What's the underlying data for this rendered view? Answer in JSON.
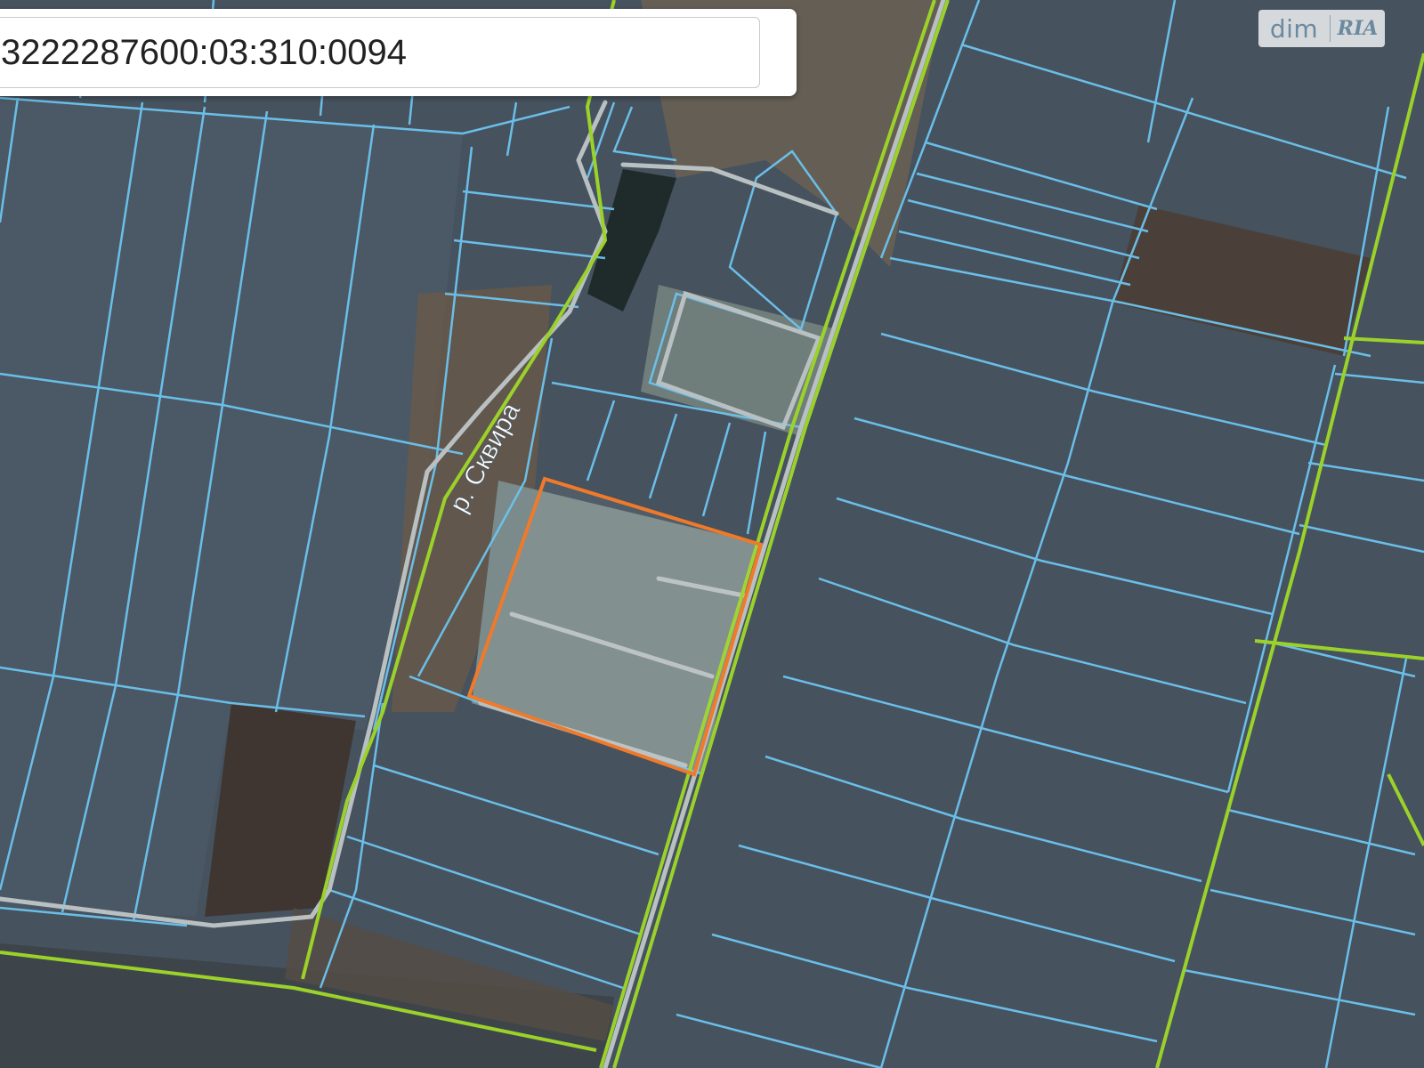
{
  "search": {
    "value": "3222287600:03:310:0094",
    "placeholder": ""
  },
  "map": {
    "river_label": "р. Сквира",
    "colors": {
      "parcel_border": "#6cc4f0",
      "road_border": "#9bd22a",
      "selected_parcel": "#f07a2a",
      "field": "#4a5865",
      "bare_soil": "#4d4038"
    }
  },
  "watermark": {
    "dim": "dim",
    "ria": "RIA"
  }
}
